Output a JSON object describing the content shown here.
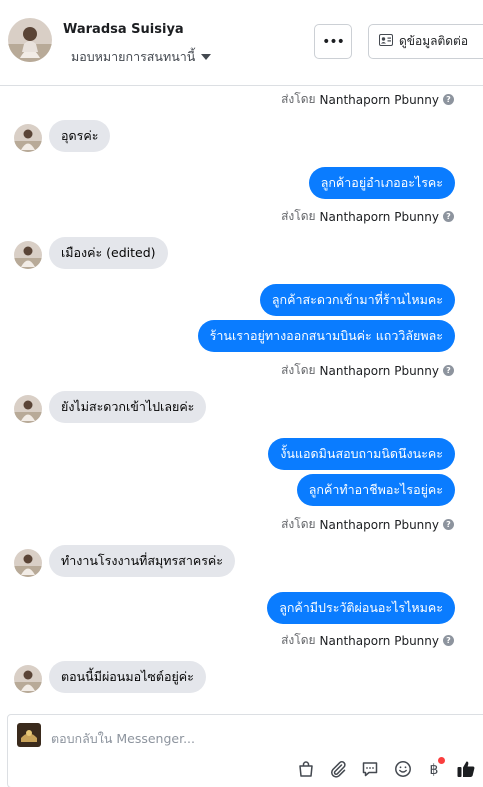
{
  "header": {
    "contact_name": "Waradsa Suisiya",
    "assign_label": "มอบหมายการสนทนานี้",
    "more_label": "•••",
    "info_button_label": "ดูข้อมูลติดต่อ"
  },
  "thread": {
    "sent_by_prefix": "ส่งโดย",
    "sender_name": "Nanthaporn Pbunny",
    "messages": [
      {
        "dir": "in",
        "text": "อุดรค่ะ"
      },
      {
        "dir": "out",
        "text": "ลูกค้าอยู่อำเภออะไรคะ"
      },
      {
        "dir": "in",
        "text": "เมืองค่ะ (edited)"
      },
      {
        "dir": "out",
        "text": "ลูกค้าสะดวกเข้ามาที่ร้านไหมคะ"
      },
      {
        "dir": "out",
        "text": "ร้านเราอยู่ทางออกสนามบินค่ะ แถววิลัยพละ"
      },
      {
        "dir": "in",
        "text": "ยังไม่สะดวกเข้าไปเลยค่ะ"
      },
      {
        "dir": "out",
        "text": "งั้นแอดมินสอบถามนิดนึงนะคะ"
      },
      {
        "dir": "out",
        "text": "ลูกค้าทำอาชีพอะไรอยู่คะ"
      },
      {
        "dir": "in",
        "text": "ทำงานโรงงานที่สมุทรสาครค่ะ"
      },
      {
        "dir": "out",
        "text": "ลูกค้ามีประวัติผ่อนอะไรไหมคะ"
      },
      {
        "dir": "in",
        "text": "ตอนนี้มีผ่อนมอไซต์อยู่ค่ะ"
      }
    ]
  },
  "composer": {
    "placeholder": "ตอบกลับใน Messenger..."
  },
  "colors": {
    "outgoing_bubble": "#0a7cff",
    "incoming_bubble": "#e4e6eb",
    "like_icon": "#1c1e21",
    "notification_dot": "#fa3e3e"
  },
  "icons": [
    "more-icon",
    "contact-card-icon",
    "caret-down-icon",
    "info-question-icon",
    "shop-bag-icon",
    "attachment-icon",
    "saved-reply-icon",
    "emoji-icon",
    "payment-baht-icon",
    "thumbs-up-icon"
  ]
}
